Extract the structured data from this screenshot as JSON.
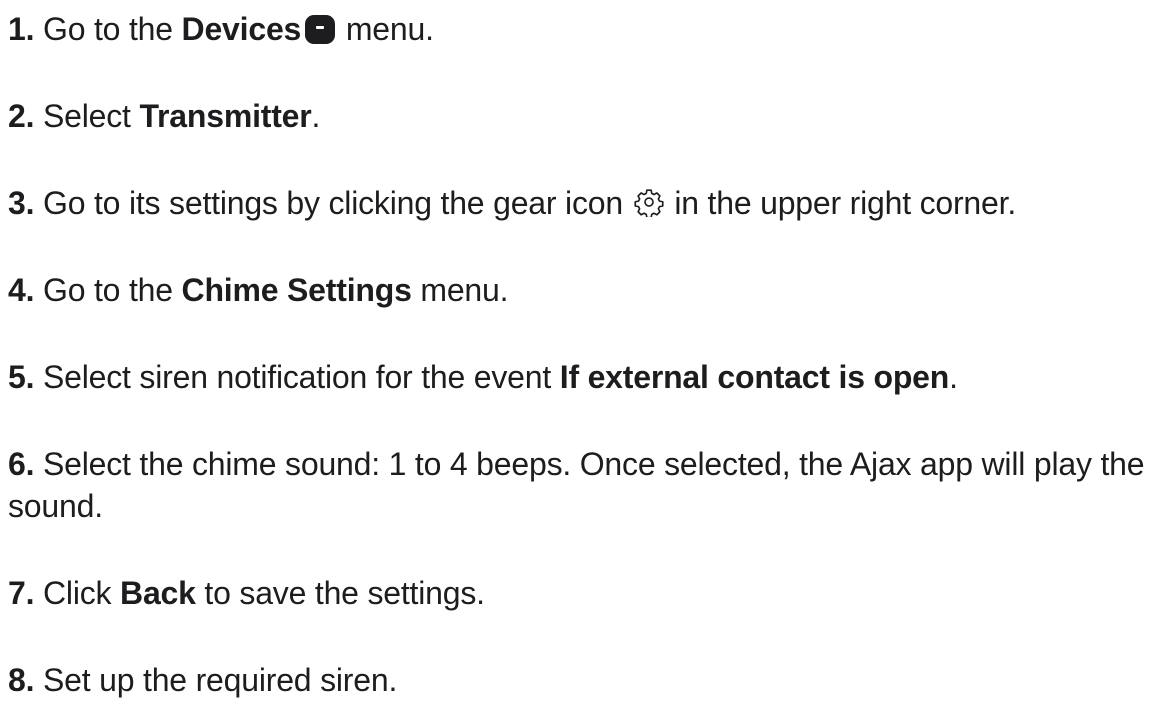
{
  "steps": [
    {
      "num": "1.",
      "pre": "Go to the ",
      "bold": "Devices",
      "icon": "devices-menu-icon",
      "post": " menu."
    },
    {
      "num": "2.",
      "pre": "Select ",
      "bold": "Transmitter",
      "post": "."
    },
    {
      "num": "3.",
      "pre": "Go to its settings by clicking the gear icon",
      "icon": "gear-icon",
      "post": " in the upper right corner."
    },
    {
      "num": "4.",
      "pre": "Go to the ",
      "bold": "Chime Settings",
      "post": " menu."
    },
    {
      "num": "5.",
      "pre": "Select siren notification for the event ",
      "bold": "If external contact is open",
      "post": "."
    },
    {
      "num": "6.",
      "pre": "Select the chime sound: 1 to 4 beeps. Once selected, the Ajax app will play the sound."
    },
    {
      "num": "7.",
      "pre": "Click ",
      "bold": "Back",
      "post": " to save the settings."
    },
    {
      "num": "8.",
      "pre": "Set up the required siren."
    }
  ]
}
